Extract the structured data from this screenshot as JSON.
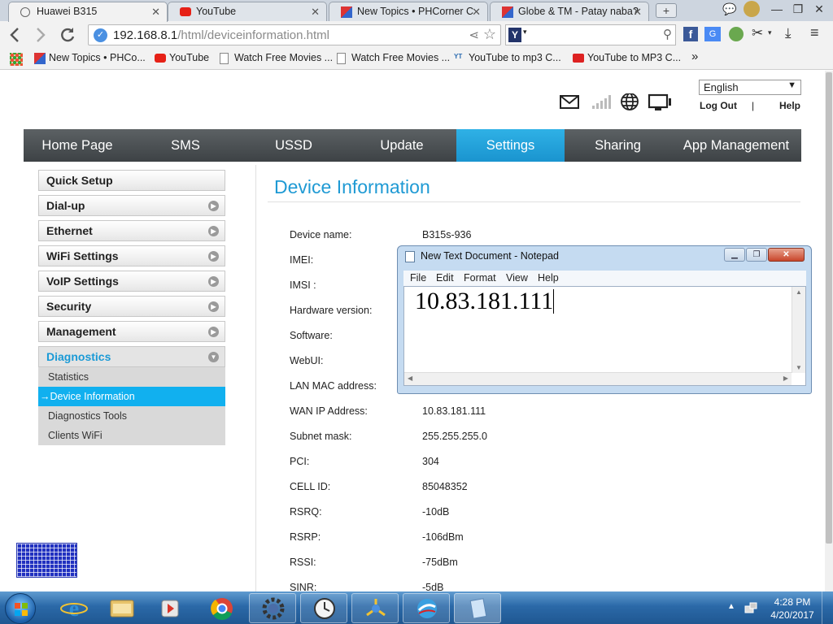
{
  "tabs": [
    {
      "title": "Huawei B315",
      "active": true
    },
    {
      "title": "YouTube",
      "active": false
    },
    {
      "title": "New Topics • PHCorner C",
      "active": false
    },
    {
      "title": "Globe & TM - Patay naba?",
      "active": false
    }
  ],
  "new_tab_label": "+",
  "address_bar": {
    "host": "192.168.8.1",
    "path": "/html/deviceinformation.html"
  },
  "bookmarks": [
    {
      "label": "New Topics • PHCo...",
      "icon": "phcorner-icon"
    },
    {
      "label": "YouTube",
      "icon": "youtube-icon"
    },
    {
      "label": "Watch Free Movies ...",
      "icon": "page-icon"
    },
    {
      "label": "Watch Free Movies ...",
      "icon": "page-icon"
    },
    {
      "label": "YouTube to mp3 C...",
      "icon": "mp3-icon"
    },
    {
      "label": "YouTube to MP3 C...",
      "icon": "mp3-red-icon"
    }
  ],
  "bookmarks_overflow": "»",
  "router": {
    "language": "English",
    "logout": "Log Out",
    "separator": "|",
    "help": "Help",
    "nav": [
      "Home Page",
      "SMS",
      "USSD",
      "Update",
      "Settings",
      "Sharing",
      "App Management"
    ],
    "active_nav": "Settings",
    "sidebar": [
      "Quick Setup",
      "Dial-up",
      "Ethernet",
      "WiFi Settings",
      "VoIP Settings",
      "Security",
      "Management",
      "Diagnostics"
    ],
    "diagnostics_sub": [
      "Statistics",
      "→Device Information",
      "Diagnostics Tools",
      "Clients WiFi"
    ],
    "page_title": "Device Information",
    "fields": [
      {
        "label": "Device name:",
        "value": "B315s-936"
      },
      {
        "label": "IMEI:",
        "value": ""
      },
      {
        "label": "IMSI :",
        "value": ""
      },
      {
        "label": "Hardware version:",
        "value": ""
      },
      {
        "label": "Software:",
        "value": ""
      },
      {
        "label": "WebUI:",
        "value": ""
      },
      {
        "label": "LAN MAC address:",
        "value": ""
      },
      {
        "label": "WAN IP Address:",
        "value": "10.83.181.111"
      },
      {
        "label": "Subnet mask:",
        "value": "255.255.255.0"
      },
      {
        "label": "PCI:",
        "value": "304"
      },
      {
        "label": "CELL ID:",
        "value": "85048352"
      },
      {
        "label": "RSRQ:",
        "value": "-10dB"
      },
      {
        "label": "RSRP:",
        "value": "-106dBm"
      },
      {
        "label": "RSSI:",
        "value": "-75dBm"
      },
      {
        "label": "SINR:",
        "value": "-5dB"
      }
    ]
  },
  "notepad": {
    "title": "New Text Document - Notepad",
    "menu": [
      "File",
      "Edit",
      "Format",
      "View",
      "Help"
    ],
    "content": "10.83.181.111"
  },
  "taskbar": {
    "time": "4:28 PM",
    "date": "4/20/2017"
  },
  "colors": {
    "accent": "#1a9ad6",
    "nav_active": "#1ea5dd",
    "nav_bg": "#4b5053",
    "taskbar": "#2b69a8"
  }
}
